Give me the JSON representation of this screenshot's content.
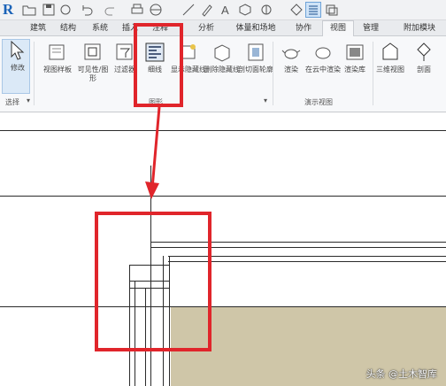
{
  "app": {
    "logo_letter": "R"
  },
  "quick_access": {
    "icons": [
      "open-icon",
      "save-icon",
      "sync-icon",
      "undo-icon",
      "redo-icon",
      "print-icon",
      "measure-icon",
      "dimension-icon",
      "tag-icon",
      "text-icon",
      "3d-view-icon",
      "section-icon",
      "thin-lines-icon",
      "close-hidden-icon",
      "switch-windows-icon"
    ]
  },
  "tabs": [
    "建筑",
    "结构",
    "系统",
    "插入",
    "注释",
    "分析",
    "体量和场地",
    "协作",
    "视图",
    "管理",
    "附加模块"
  ],
  "active_tab": "视图",
  "ribbon": {
    "buttons": [
      {
        "label": "修改"
      },
      {
        "label": "视图样板"
      },
      {
        "label": "可见性/图形"
      },
      {
        "label": "过滤器"
      },
      {
        "label": "细线"
      },
      {
        "label": "显示隐藏线"
      },
      {
        "label": "删除隐藏线"
      },
      {
        "label": "剖切面轮廓"
      },
      {
        "label": "渲染"
      },
      {
        "label": "在云中渲染"
      },
      {
        "label": "渲染库"
      },
      {
        "label": "三维视图"
      },
      {
        "label": "剖面"
      }
    ],
    "groups": {
      "select": "选择",
      "graphics": "图形",
      "presentation": "演示视图"
    }
  },
  "watermark": "头条 @土木智库",
  "colors": {
    "highlight_box": "#e0252b",
    "cut_fill": "#cfc6a8",
    "active_tab_bg": "#f6f7f9"
  }
}
